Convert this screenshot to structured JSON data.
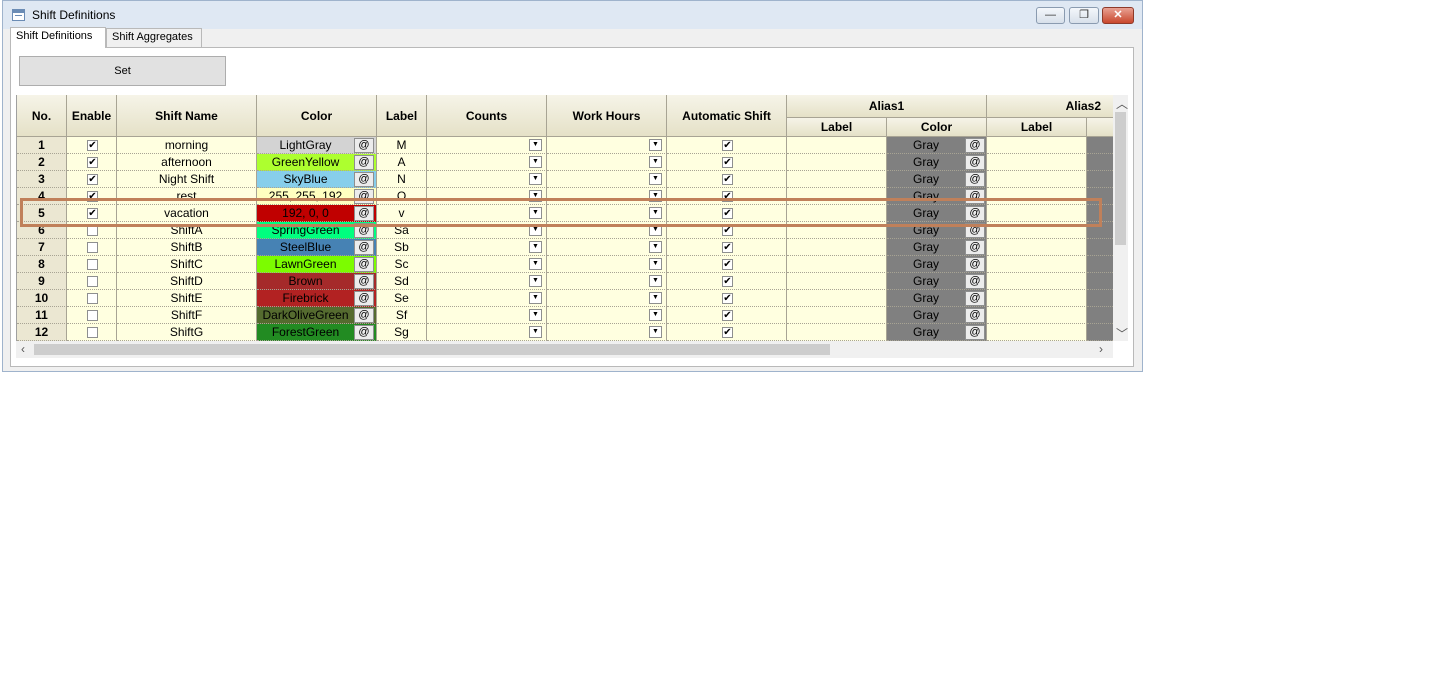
{
  "window": {
    "title": "Shift Definitions",
    "minimize_label": "—",
    "restore_label": "❐",
    "close_label": "✕"
  },
  "tabs": [
    "Shift Definitions",
    "Shift Aggregates"
  ],
  "set_button": "Set",
  "columns": {
    "no": "No.",
    "enable": "Enable",
    "shift_name": "Shift Name",
    "color": "Color",
    "label": "Label",
    "counts": "Counts",
    "work_hours": "Work Hours",
    "automatic_shift": "Automatic Shift",
    "alias1": "Alias1",
    "alias2": "Alias2",
    "alias_label": "Label",
    "alias_color": "Color"
  },
  "at_symbol": "@",
  "rows": [
    {
      "no": "1",
      "enabled": true,
      "name": "morning",
      "color_name": "LightGray",
      "bg": "#d3d3d3",
      "fg": "#000000",
      "label": "M",
      "auto": true,
      "alias_color": "Gray"
    },
    {
      "no": "2",
      "enabled": true,
      "name": "afternoon",
      "color_name": "GreenYellow",
      "bg": "#adff2f",
      "fg": "#000000",
      "label": "A",
      "auto": true,
      "alias_color": "Gray"
    },
    {
      "no": "3",
      "enabled": true,
      "name": "Night Shift",
      "color_name": "SkyBlue",
      "bg": "#87ceeb",
      "fg": "#000000",
      "label": "N",
      "auto": true,
      "alias_color": "Gray"
    },
    {
      "no": "4",
      "enabled": true,
      "name": "rest",
      "color_name": "255, 255, 192",
      "bg": "#ffffc0",
      "fg": "#000000",
      "label": "O",
      "auto": true,
      "alias_color": "Gray"
    },
    {
      "no": "5",
      "enabled": true,
      "name": "vacation",
      "color_name": "192, 0, 0",
      "bg": "#c00000",
      "fg": "#000000",
      "label": "v",
      "auto": true,
      "alias_color": "Gray"
    },
    {
      "no": "6",
      "enabled": false,
      "name": "ShiftA",
      "color_name": "SpringGreen",
      "bg": "#00ff7f",
      "fg": "#000000",
      "label": "Sa",
      "auto": true,
      "alias_color": "Gray"
    },
    {
      "no": "7",
      "enabled": false,
      "name": "ShiftB",
      "color_name": "SteelBlue",
      "bg": "#4682b4",
      "fg": "#000000",
      "label": "Sb",
      "auto": true,
      "alias_color": "Gray"
    },
    {
      "no": "8",
      "enabled": false,
      "name": "ShiftC",
      "color_name": "LawnGreen",
      "bg": "#7cfc00",
      "fg": "#000000",
      "label": "Sc",
      "auto": true,
      "alias_color": "Gray"
    },
    {
      "no": "9",
      "enabled": false,
      "name": "ShiftD",
      "color_name": "Brown",
      "bg": "#a52a2a",
      "fg": "#000000",
      "label": "Sd",
      "auto": true,
      "alias_color": "Gray"
    },
    {
      "no": "10",
      "enabled": false,
      "name": "ShiftE",
      "color_name": "Firebrick",
      "bg": "#b22222",
      "fg": "#000000",
      "label": "Se",
      "auto": true,
      "alias_color": "Gray"
    },
    {
      "no": "11",
      "enabled": false,
      "name": "ShiftF",
      "color_name": "DarkOliveGreen",
      "bg": "#556b2f",
      "fg": "#000000",
      "label": "Sf",
      "auto": true,
      "alias_color": "Gray"
    },
    {
      "no": "12",
      "enabled": false,
      "name": "ShiftG",
      "color_name": "ForestGreen",
      "bg": "#228b22",
      "fg": "#000000",
      "label": "Sg",
      "auto": true,
      "alias_color": "Gray"
    }
  ],
  "alias_color_bg": "#808080",
  "check_mark": "✔",
  "dropdown_glyph": "▼"
}
